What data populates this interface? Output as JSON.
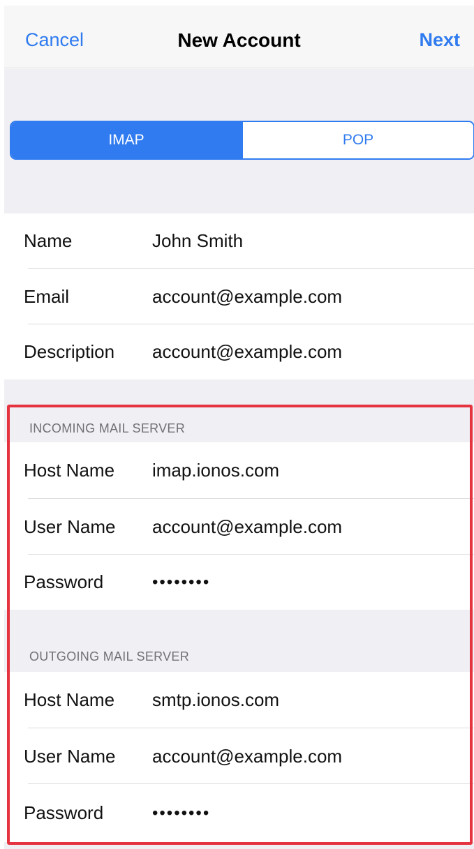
{
  "nav": {
    "cancel_label": "Cancel",
    "title": "New Account",
    "next_label": "Next"
  },
  "segmented": {
    "options": [
      "IMAP",
      "POP"
    ],
    "selected": "IMAP"
  },
  "account": {
    "name": {
      "label": "Name",
      "value": "John Smith"
    },
    "email": {
      "label": "Email",
      "value": "account@example.com"
    },
    "description": {
      "label": "Description",
      "value": "account@example.com"
    }
  },
  "incoming": {
    "header": "INCOMING MAIL SERVER",
    "host": {
      "label": "Host Name",
      "value": "imap.ionos.com"
    },
    "user": {
      "label": "User Name",
      "value": "account@example.com"
    },
    "password": {
      "label": "Password",
      "value": "••••••••"
    }
  },
  "outgoing": {
    "header": "OUTGOING MAIL SERVER",
    "host": {
      "label": "Host Name",
      "value": "smtp.ionos.com"
    },
    "user": {
      "label": "User Name",
      "value": "account@example.com"
    },
    "password": {
      "label": "Password",
      "value": "••••••••"
    }
  },
  "colors": {
    "accent": "#2f7bef",
    "highlight": "#e5333f",
    "grouped_background": "#efeff4"
  }
}
